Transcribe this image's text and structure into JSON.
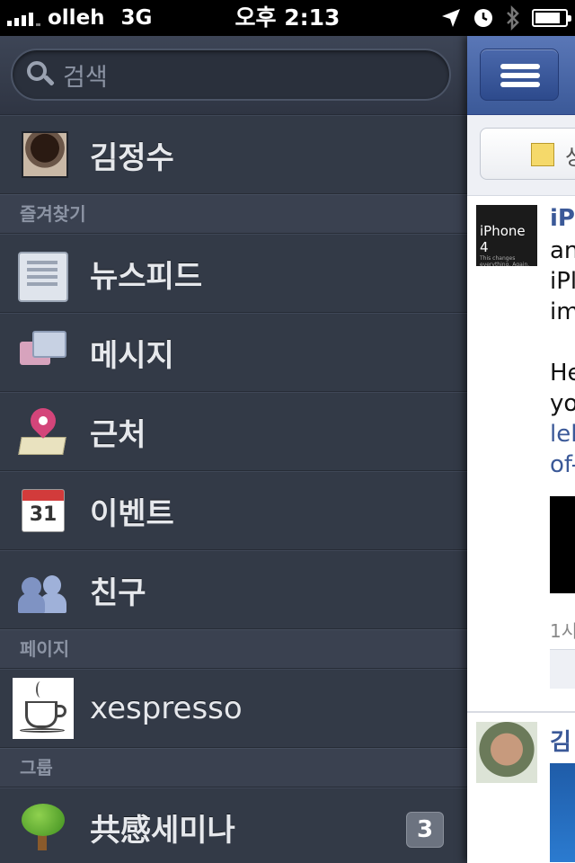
{
  "status_bar": {
    "carrier": "olleh",
    "network": "3G",
    "time": "오후 2:13",
    "battery_level": 0.85
  },
  "sidebar": {
    "search": {
      "placeholder": "검색"
    },
    "profile": {
      "name": "김정수"
    },
    "sections": {
      "favorites": "즐겨찾기",
      "pages": "페이지",
      "groups": "그룹"
    },
    "favorites": [
      {
        "label": "뉴스피드",
        "icon": "news-feed-icon"
      },
      {
        "label": "메시지",
        "icon": "messages-icon"
      },
      {
        "label": "근처",
        "icon": "nearby-pin-icon"
      },
      {
        "label": "이벤트",
        "icon": "events-calendar-icon"
      },
      {
        "label": "친구",
        "icon": "friends-icon"
      }
    ],
    "calendar_day": "31",
    "pages": [
      {
        "label": "xespresso",
        "icon": "coffee-cup-icon"
      }
    ],
    "groups": [
      {
        "label": "共感세미나",
        "icon": "tree-icon",
        "badge": "3"
      }
    ]
  },
  "feed": {
    "post1": {
      "author_partial": "iPl",
      "lines": [
        "an",
        "iPl",
        "im"
      ],
      "lines2": [
        "He",
        "yo"
      ],
      "link_lines": [
        "lel",
        "of-"
      ],
      "thumb_text": "iPhone 4",
      "thumb_sub": "This changes everything. Again.",
      "meta": "1시"
    },
    "post2": {
      "author_partial": "김"
    },
    "status_button_partial": "상"
  }
}
